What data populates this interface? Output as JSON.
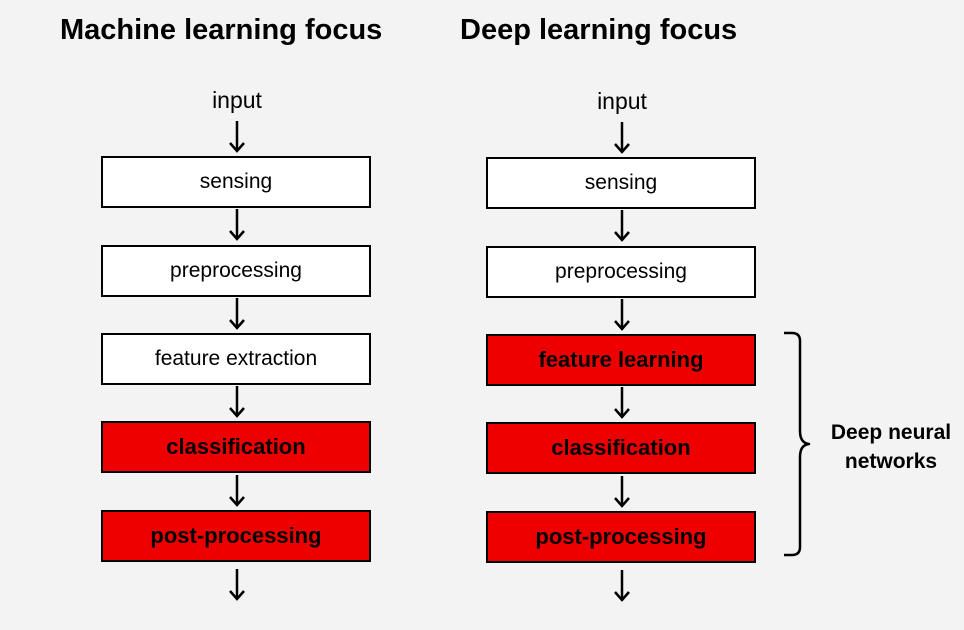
{
  "columns": {
    "ml": {
      "title": "Machine learning focus",
      "input": "input",
      "steps": {
        "sensing": "sensing",
        "preprocessing": "preprocessing",
        "feature_extraction": "feature extraction",
        "classification": "classification",
        "post_processing": "post-processing"
      }
    },
    "dl": {
      "title": "Deep learning focus",
      "input": "input",
      "steps": {
        "sensing": "sensing",
        "preprocessing": "preprocessing",
        "feature_learning": "feature learning",
        "classification": "classification",
        "post_processing": "post-processing"
      }
    }
  },
  "brace": {
    "line1": "Deep neural",
    "line2": "networks"
  },
  "colors": {
    "highlight": "#ee0000",
    "plain": "#ffffff",
    "background": "#f3f3f3"
  }
}
